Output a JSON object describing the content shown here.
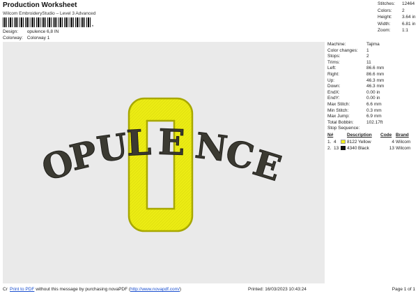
{
  "header": {
    "title": "Production Worksheet",
    "subtitle": "Wilcom EmbroideryStudio – Level 3 Advanced",
    "barcode_mark": ",",
    "design_label": "Design:",
    "design_value": "opulence 6,8 IN",
    "colorway_label": "Colorway:",
    "colorway_value": "Colorway 1"
  },
  "stats": {
    "items": [
      {
        "label": "Stitches:",
        "value": "12464"
      },
      {
        "label": "Colors:",
        "value": "2"
      },
      {
        "label": "Height:",
        "value": "3.64 in"
      },
      {
        "label": "Width:",
        "value": "6.81 in"
      },
      {
        "label": "Zoom:",
        "value": "1:1"
      }
    ]
  },
  "design": {
    "letters_left": [
      "O",
      "P",
      "U",
      "L",
      "E"
    ],
    "letters_right": [
      "N",
      "C",
      "E"
    ],
    "big_letter": "O",
    "colors": {
      "yellow": "#ecec14",
      "yellow_dark": "#b7b700",
      "black": "#3b3a32",
      "canvas": "#eaeaea"
    }
  },
  "info": {
    "items": [
      {
        "label": "Machine:",
        "value": "Tajima"
      },
      {
        "label": "Color changes:",
        "value": "1"
      },
      {
        "label": "Stops:",
        "value": "2"
      },
      {
        "label": "Trims:",
        "value": "11"
      },
      {
        "label": "Left:",
        "value": "86.6 mm"
      },
      {
        "label": "Right:",
        "value": "86.6 mm"
      },
      {
        "label": "Up:",
        "value": "46.3 mm"
      },
      {
        "label": "Down:",
        "value": "46.3 mm"
      },
      {
        "label": "EndX:",
        "value": "0.00 in"
      },
      {
        "label": "EndY:",
        "value": "0.00 in"
      },
      {
        "label": "Max Stitch:",
        "value": "6.6 mm"
      },
      {
        "label": "Min Stitch:",
        "value": "0.3 mm"
      },
      {
        "label": "Max Jump:",
        "value": "6.9 mm"
      },
      {
        "label": "Total Bobbin:",
        "value": "102.17ft"
      }
    ],
    "stop_sequence_label": "Stop Sequence:",
    "seq_headers": {
      "n": "N#",
      "num": "",
      "desc": "Description",
      "code": "Code",
      "brand": "Brand"
    },
    "seq_rows": [
      {
        "n": "1.",
        "num": "4",
        "color": "#f2ef1a",
        "code": "8122",
        "desc": "Yellow",
        "code2": "4",
        "brand": "Wilcom"
      },
      {
        "n": "2.",
        "num": "13",
        "color": "#111111",
        "code": "4340",
        "desc": "Black",
        "code2": "13",
        "brand": "Wilcom"
      }
    ]
  },
  "footer": {
    "cr": "Cr",
    "link_text": "Print to PDF",
    "message": " without this message by purchasing novaPDF (",
    "url": "http://www.novapdf.com/",
    "close": ")",
    "printed": "Printed: 16/03/2023 10:43:24",
    "page": "Page 1 of 1"
  }
}
